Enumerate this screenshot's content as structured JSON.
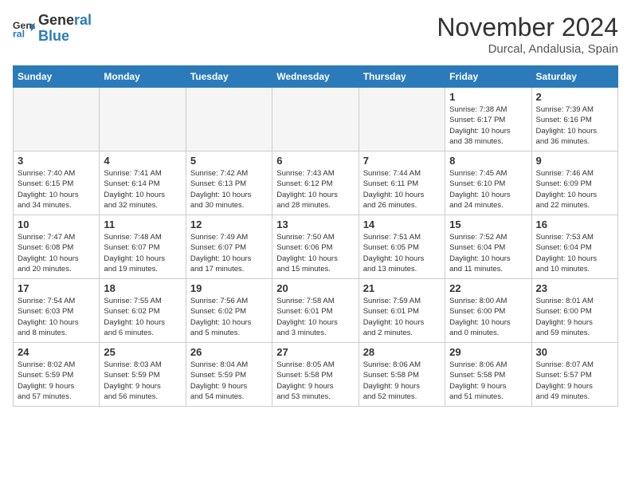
{
  "header": {
    "logo_line1": "General",
    "logo_line2": "Blue",
    "month": "November 2024",
    "location": "Durcal, Andalusia, Spain"
  },
  "weekdays": [
    "Sunday",
    "Monday",
    "Tuesday",
    "Wednesday",
    "Thursday",
    "Friday",
    "Saturday"
  ],
  "weeks": [
    [
      {
        "day": "",
        "info": ""
      },
      {
        "day": "",
        "info": ""
      },
      {
        "day": "",
        "info": ""
      },
      {
        "day": "",
        "info": ""
      },
      {
        "day": "",
        "info": ""
      },
      {
        "day": "1",
        "info": "Sunrise: 7:38 AM\nSunset: 6:17 PM\nDaylight: 10 hours\nand 38 minutes."
      },
      {
        "day": "2",
        "info": "Sunrise: 7:39 AM\nSunset: 6:16 PM\nDaylight: 10 hours\nand 36 minutes."
      }
    ],
    [
      {
        "day": "3",
        "info": "Sunrise: 7:40 AM\nSunset: 6:15 PM\nDaylight: 10 hours\nand 34 minutes."
      },
      {
        "day": "4",
        "info": "Sunrise: 7:41 AM\nSunset: 6:14 PM\nDaylight: 10 hours\nand 32 minutes."
      },
      {
        "day": "5",
        "info": "Sunrise: 7:42 AM\nSunset: 6:13 PM\nDaylight: 10 hours\nand 30 minutes."
      },
      {
        "day": "6",
        "info": "Sunrise: 7:43 AM\nSunset: 6:12 PM\nDaylight: 10 hours\nand 28 minutes."
      },
      {
        "day": "7",
        "info": "Sunrise: 7:44 AM\nSunset: 6:11 PM\nDaylight: 10 hours\nand 26 minutes."
      },
      {
        "day": "8",
        "info": "Sunrise: 7:45 AM\nSunset: 6:10 PM\nDaylight: 10 hours\nand 24 minutes."
      },
      {
        "day": "9",
        "info": "Sunrise: 7:46 AM\nSunset: 6:09 PM\nDaylight: 10 hours\nand 22 minutes."
      }
    ],
    [
      {
        "day": "10",
        "info": "Sunrise: 7:47 AM\nSunset: 6:08 PM\nDaylight: 10 hours\nand 20 minutes."
      },
      {
        "day": "11",
        "info": "Sunrise: 7:48 AM\nSunset: 6:07 PM\nDaylight: 10 hours\nand 19 minutes."
      },
      {
        "day": "12",
        "info": "Sunrise: 7:49 AM\nSunset: 6:07 PM\nDaylight: 10 hours\nand 17 minutes."
      },
      {
        "day": "13",
        "info": "Sunrise: 7:50 AM\nSunset: 6:06 PM\nDaylight: 10 hours\nand 15 minutes."
      },
      {
        "day": "14",
        "info": "Sunrise: 7:51 AM\nSunset: 6:05 PM\nDaylight: 10 hours\nand 13 minutes."
      },
      {
        "day": "15",
        "info": "Sunrise: 7:52 AM\nSunset: 6:04 PM\nDaylight: 10 hours\nand 11 minutes."
      },
      {
        "day": "16",
        "info": "Sunrise: 7:53 AM\nSunset: 6:04 PM\nDaylight: 10 hours\nand 10 minutes."
      }
    ],
    [
      {
        "day": "17",
        "info": "Sunrise: 7:54 AM\nSunset: 6:03 PM\nDaylight: 10 hours\nand 8 minutes."
      },
      {
        "day": "18",
        "info": "Sunrise: 7:55 AM\nSunset: 6:02 PM\nDaylight: 10 hours\nand 6 minutes."
      },
      {
        "day": "19",
        "info": "Sunrise: 7:56 AM\nSunset: 6:02 PM\nDaylight: 10 hours\nand 5 minutes."
      },
      {
        "day": "20",
        "info": "Sunrise: 7:58 AM\nSunset: 6:01 PM\nDaylight: 10 hours\nand 3 minutes."
      },
      {
        "day": "21",
        "info": "Sunrise: 7:59 AM\nSunset: 6:01 PM\nDaylight: 10 hours\nand 2 minutes."
      },
      {
        "day": "22",
        "info": "Sunrise: 8:00 AM\nSunset: 6:00 PM\nDaylight: 10 hours\nand 0 minutes."
      },
      {
        "day": "23",
        "info": "Sunrise: 8:01 AM\nSunset: 6:00 PM\nDaylight: 9 hours\nand 59 minutes."
      }
    ],
    [
      {
        "day": "24",
        "info": "Sunrise: 8:02 AM\nSunset: 5:59 PM\nDaylight: 9 hours\nand 57 minutes."
      },
      {
        "day": "25",
        "info": "Sunrise: 8:03 AM\nSunset: 5:59 PM\nDaylight: 9 hours\nand 56 minutes."
      },
      {
        "day": "26",
        "info": "Sunrise: 8:04 AM\nSunset: 5:59 PM\nDaylight: 9 hours\nand 54 minutes."
      },
      {
        "day": "27",
        "info": "Sunrise: 8:05 AM\nSunset: 5:58 PM\nDaylight: 9 hours\nand 53 minutes."
      },
      {
        "day": "28",
        "info": "Sunrise: 8:06 AM\nSunset: 5:58 PM\nDaylight: 9 hours\nand 52 minutes."
      },
      {
        "day": "29",
        "info": "Sunrise: 8:06 AM\nSunset: 5:58 PM\nDaylight: 9 hours\nand 51 minutes."
      },
      {
        "day": "30",
        "info": "Sunrise: 8:07 AM\nSunset: 5:57 PM\nDaylight: 9 hours\nand 49 minutes."
      }
    ]
  ]
}
